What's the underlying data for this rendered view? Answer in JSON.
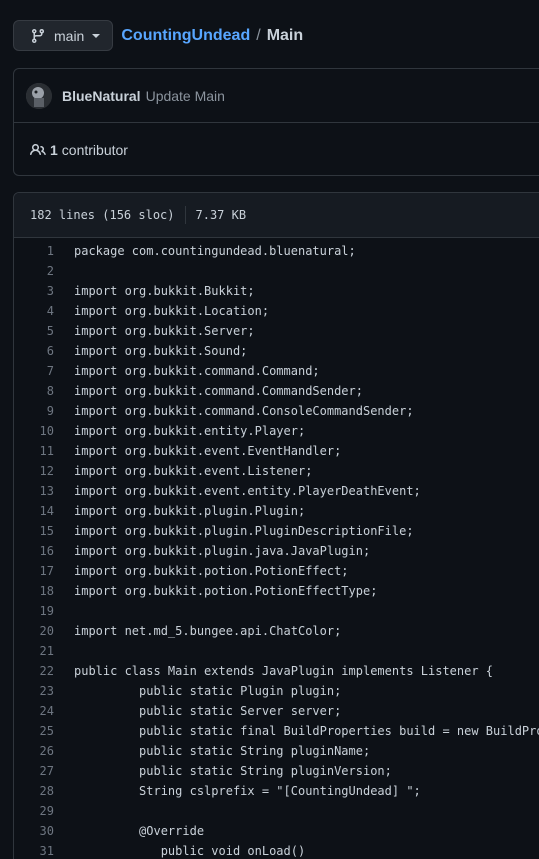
{
  "branch": {
    "label": "main",
    "icon": "git-branch-icon"
  },
  "breadcrumb": {
    "repo": "CountingUndead",
    "separator": "/",
    "file": "Main"
  },
  "commit": {
    "author": "BlueNatural",
    "message": "Update Main",
    "avatar_icon": "avatar"
  },
  "contributors": {
    "count": "1",
    "label": "contributor",
    "icon": "people-icon"
  },
  "file_info": {
    "lines": "182 lines (156 sloc)",
    "size": "7.37 KB"
  },
  "code_lines": [
    {
      "n": "1",
      "text": "package com.countingundead.bluenatural;"
    },
    {
      "n": "2",
      "text": ""
    },
    {
      "n": "3",
      "text": "import org.bukkit.Bukkit;"
    },
    {
      "n": "4",
      "text": "import org.bukkit.Location;"
    },
    {
      "n": "5",
      "text": "import org.bukkit.Server;"
    },
    {
      "n": "6",
      "text": "import org.bukkit.Sound;"
    },
    {
      "n": "7",
      "text": "import org.bukkit.command.Command;"
    },
    {
      "n": "8",
      "text": "import org.bukkit.command.CommandSender;"
    },
    {
      "n": "9",
      "text": "import org.bukkit.command.ConsoleCommandSender;"
    },
    {
      "n": "10",
      "text": "import org.bukkit.entity.Player;"
    },
    {
      "n": "11",
      "text": "import org.bukkit.event.EventHandler;"
    },
    {
      "n": "12",
      "text": "import org.bukkit.event.Listener;"
    },
    {
      "n": "13",
      "text": "import org.bukkit.event.entity.PlayerDeathEvent;"
    },
    {
      "n": "14",
      "text": "import org.bukkit.plugin.Plugin;"
    },
    {
      "n": "15",
      "text": "import org.bukkit.plugin.PluginDescriptionFile;"
    },
    {
      "n": "16",
      "text": "import org.bukkit.plugin.java.JavaPlugin;"
    },
    {
      "n": "17",
      "text": "import org.bukkit.potion.PotionEffect;"
    },
    {
      "n": "18",
      "text": "import org.bukkit.potion.PotionEffectType;"
    },
    {
      "n": "19",
      "text": ""
    },
    {
      "n": "20",
      "text": "import net.md_5.bungee.api.ChatColor;"
    },
    {
      "n": "21",
      "text": ""
    },
    {
      "n": "22",
      "text": "public class Main extends JavaPlugin implements Listener {"
    },
    {
      "n": "23",
      "text": "         public static Plugin plugin;"
    },
    {
      "n": "24",
      "text": "         public static Server server;"
    },
    {
      "n": "25",
      "text": "         public static final BuildProperties build = new BuildProperties"
    },
    {
      "n": "26",
      "text": "         public static String pluginName;"
    },
    {
      "n": "27",
      "text": "         public static String pluginVersion;"
    },
    {
      "n": "28",
      "text": "         String cslprefix = \"[CountingUndead] \";"
    },
    {
      "n": "29",
      "text": ""
    },
    {
      "n": "30",
      "text": "         @Override"
    },
    {
      "n": "31",
      "text": "            public void onLoad()"
    }
  ]
}
